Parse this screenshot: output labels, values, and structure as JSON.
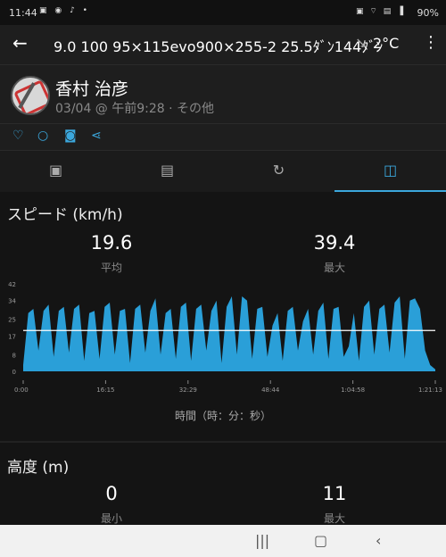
{
  "status_bar": {
    "time": "11:44",
    "battery": "90%"
  },
  "app_bar": {
    "title": "9.0 100 95×115evo900×255-2 25.5ﾀﾞﾝ144ﾀﾞﾝ",
    "temperature": "2°C"
  },
  "profile": {
    "name": "香村 治彦",
    "meta": "03/04 @ 午前9:28 · その他"
  },
  "tabs": [
    {
      "icon": "summary-icon",
      "active": false
    },
    {
      "icon": "details-icon",
      "active": false
    },
    {
      "icon": "laps-icon",
      "active": false
    },
    {
      "icon": "charts-icon",
      "active": true
    }
  ],
  "speed": {
    "title": "スピード (km/h)",
    "avg_value": "19.6",
    "avg_label": "平均",
    "max_value": "39.4",
    "max_label": "最大",
    "xlabel": "時間（時：分：秒）"
  },
  "elevation": {
    "title": "高度 (m)",
    "min_value": "0",
    "min_label": "最小",
    "max_value": "11",
    "max_label": "最大"
  },
  "chart_data": {
    "type": "area",
    "x_ticks": [
      "0:00",
      "16:15",
      "32:29",
      "48:44",
      "1:04:58",
      "1:21:13"
    ],
    "y_ticks": [
      0,
      8,
      17,
      25,
      34,
      42
    ],
    "ylim": [
      0,
      42
    ],
    "average_line": 19.6,
    "fill_color": "#2a9fd8",
    "average_color": "#ffffff",
    "x_minutes": [
      0,
      1,
      2,
      3,
      4,
      5,
      6,
      7,
      8,
      9,
      10,
      11,
      12,
      13,
      14,
      15,
      16,
      17,
      18,
      19,
      20,
      21,
      22,
      23,
      24,
      25,
      26,
      27,
      28,
      29,
      30,
      31,
      32,
      33,
      34,
      35,
      36,
      37,
      38,
      39,
      40,
      41,
      42,
      43,
      44,
      45,
      46,
      47,
      48,
      49,
      50,
      51,
      52,
      53,
      54,
      55,
      56,
      57,
      58,
      59,
      60,
      61,
      62,
      63,
      64,
      65,
      66,
      67,
      68,
      69,
      70,
      71,
      72,
      73,
      74,
      75,
      76,
      77,
      78,
      79,
      80,
      81
    ],
    "values": [
      3,
      28,
      30,
      10,
      29,
      32,
      7,
      29,
      31,
      9,
      30,
      32,
      5,
      28,
      29,
      6,
      31,
      33,
      8,
      29,
      30,
      4,
      30,
      32,
      9,
      29,
      35,
      8,
      28,
      30,
      6,
      31,
      33,
      5,
      30,
      32,
      10,
      29,
      34,
      4,
      31,
      36,
      8,
      36,
      34,
      6,
      30,
      31,
      7,
      22,
      28,
      5,
      29,
      31,
      10,
      24,
      30,
      8,
      29,
      33,
      6,
      30,
      31,
      7,
      12,
      28,
      5,
      31,
      34,
      8,
      30,
      32,
      9,
      33,
      36,
      6,
      34,
      35,
      30,
      10,
      3,
      1
    ]
  }
}
